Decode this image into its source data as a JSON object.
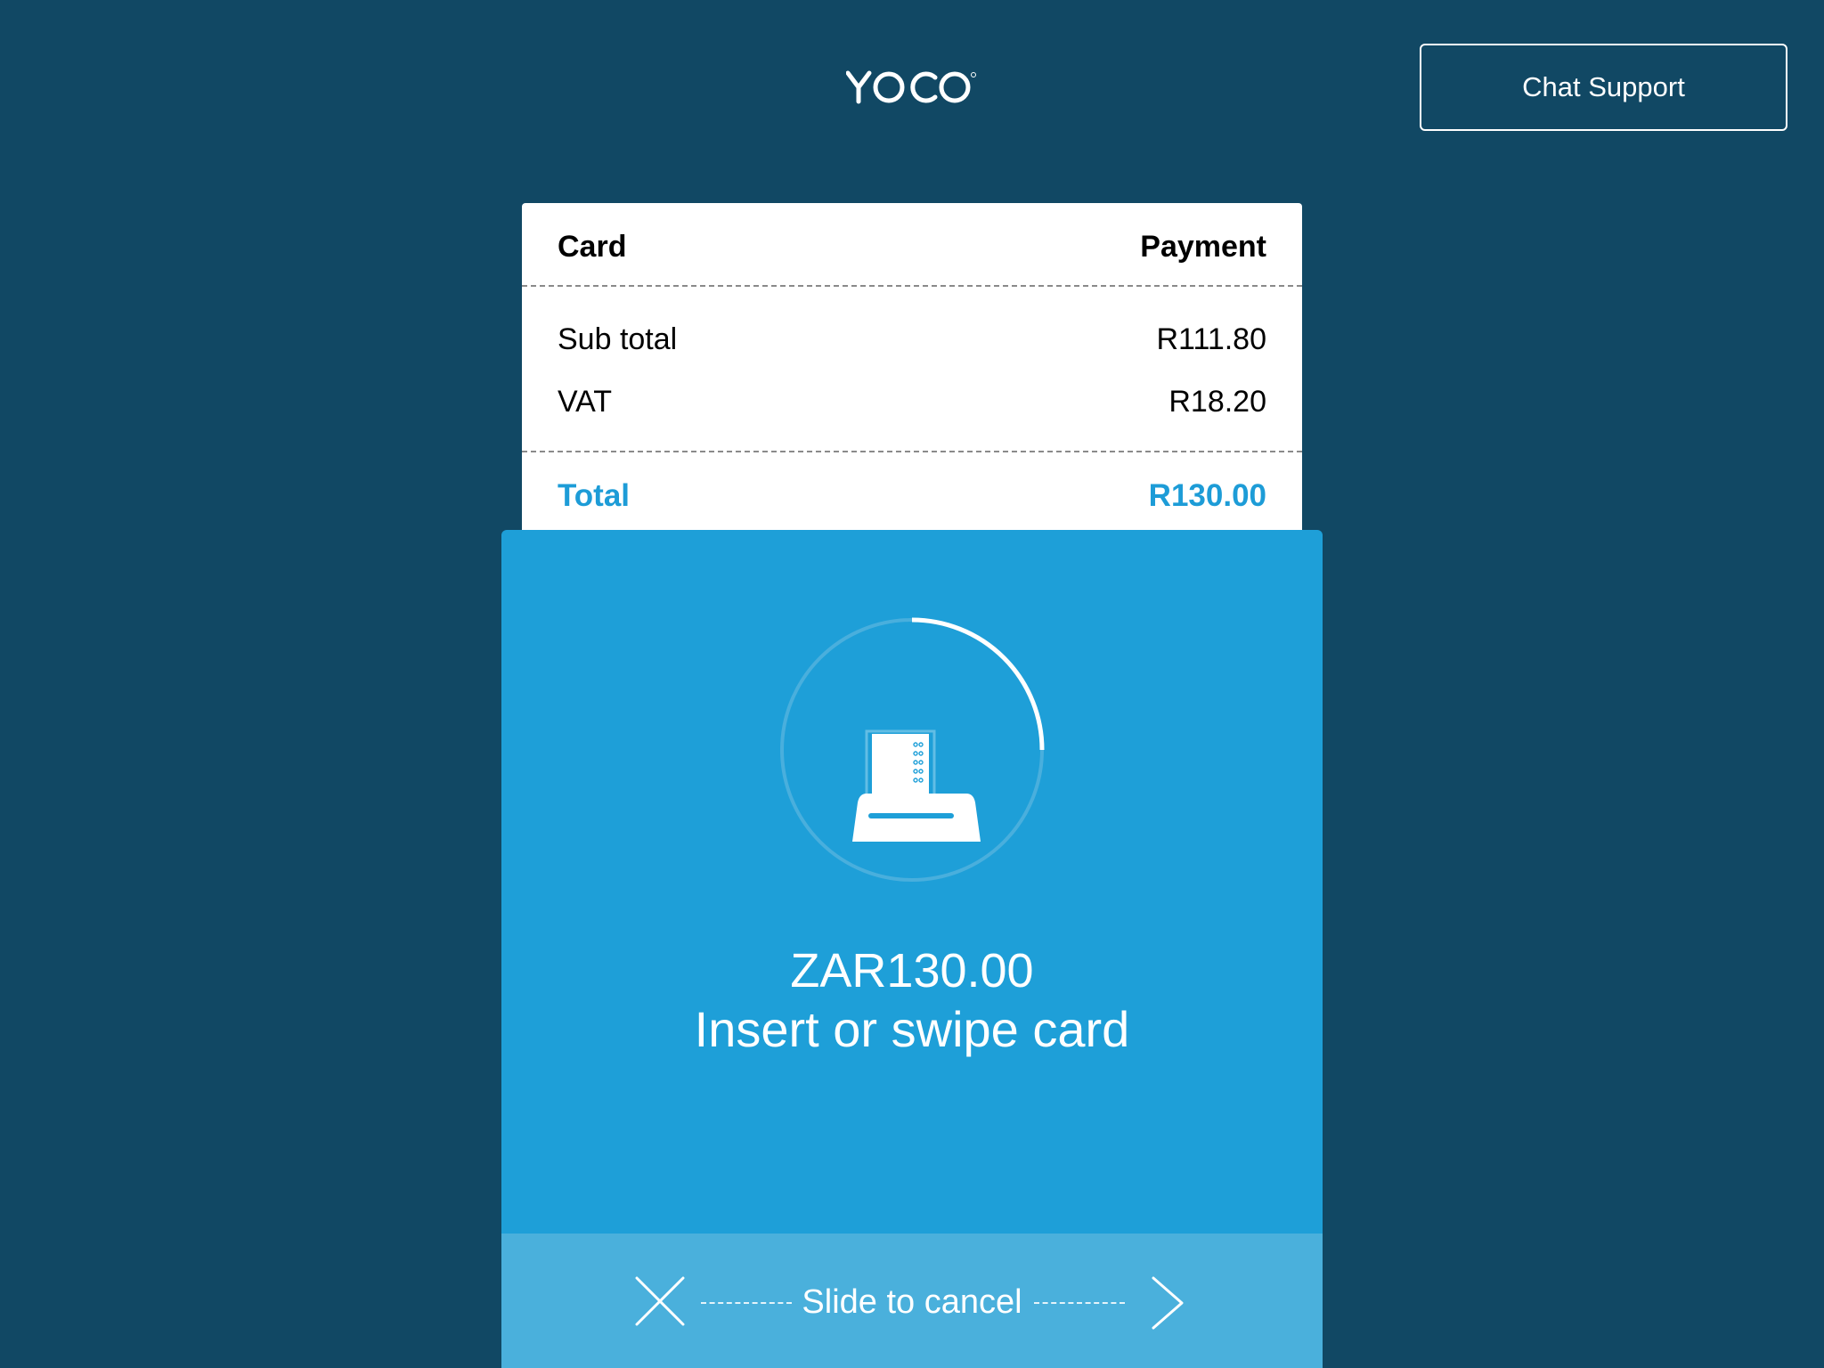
{
  "header": {
    "logo_text": "YOCO",
    "chat_support_label": "Chat Support"
  },
  "receipt": {
    "title_left": "Card",
    "title_right": "Payment",
    "lines": [
      {
        "label": "Sub total",
        "value": "R111.80"
      },
      {
        "label": "VAT",
        "value": "R18.20"
      }
    ],
    "total_label": "Total",
    "total_value": "R130.00"
  },
  "payment": {
    "amount": "ZAR130.00",
    "instruction": "Insert or swipe card",
    "progress": 0.25,
    "slide_text": "Slide to cancel"
  },
  "colors": {
    "background": "#114864",
    "accent": "#1d9cd7",
    "panel": "#1e9fd8",
    "slider": "#4ab0dc"
  },
  "icons": {
    "reader": "card-reader-icon",
    "cancel": "close-icon",
    "slide": "chevron-right-icon"
  }
}
